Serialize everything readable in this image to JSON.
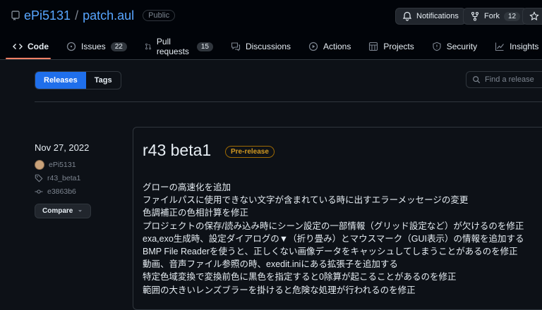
{
  "repo": {
    "owner": "ePi5131",
    "sep": "/",
    "name": "patch.aul",
    "visibility": "Public"
  },
  "header_buttons": {
    "notifications": "Notifications",
    "fork": "Fork",
    "fork_count": "12"
  },
  "tabs": [
    {
      "label": "Code",
      "icon": "code-icon"
    },
    {
      "label": "Issues",
      "count": "22",
      "icon": "issue-icon"
    },
    {
      "label": "Pull requests",
      "count": "15",
      "icon": "pr-icon"
    },
    {
      "label": "Discussions",
      "icon": "discussion-icon"
    },
    {
      "label": "Actions",
      "icon": "actions-icon"
    },
    {
      "label": "Projects",
      "icon": "projects-icon"
    },
    {
      "label": "Security",
      "icon": "shield-icon"
    },
    {
      "label": "Insights",
      "icon": "graph-icon"
    }
  ],
  "subnav": {
    "releases": "Releases",
    "tags": "Tags",
    "search_placeholder": "Find a release"
  },
  "release": {
    "date": "Nov 27, 2022",
    "author": "ePi5131",
    "tag": "r43_beta1",
    "commit": "e3863b6",
    "compare": "Compare",
    "title": "r43 beta1",
    "badge": "Pre-release",
    "notes": [
      "グローの高速化を追加",
      "ファイルパスに使用できない文字が含まれている時に出すエラーメッセージの変更",
      "色調補正の色相計算を修正",
      "プロジェクトの保存/読み込み時にシーン設定の一部情報（グリッド設定など）が欠けるのを修正",
      "exa,exo生成時、設定ダイアログの▼（折り畳み）とマウスマーク（GUI表示）の情報を追加する",
      "BMP File Readerを使うと、正しくない画像データをキャッシュしてしまうことがあるのを修正",
      "動画、音声ファイル参照の時、exedit.iniにある拡張子を追加する",
      "特定色域変換で変換前色に黒色を指定すると0除算が起こることがあるのを修正",
      "範囲の大きいレンズブラーを掛けると危険な処理が行われるのを修正"
    ]
  },
  "colors": {
    "accent": "#58a6ff",
    "tab_underline": "#f78166",
    "selected": "#1f6feb",
    "prerelease": "#d29922"
  }
}
